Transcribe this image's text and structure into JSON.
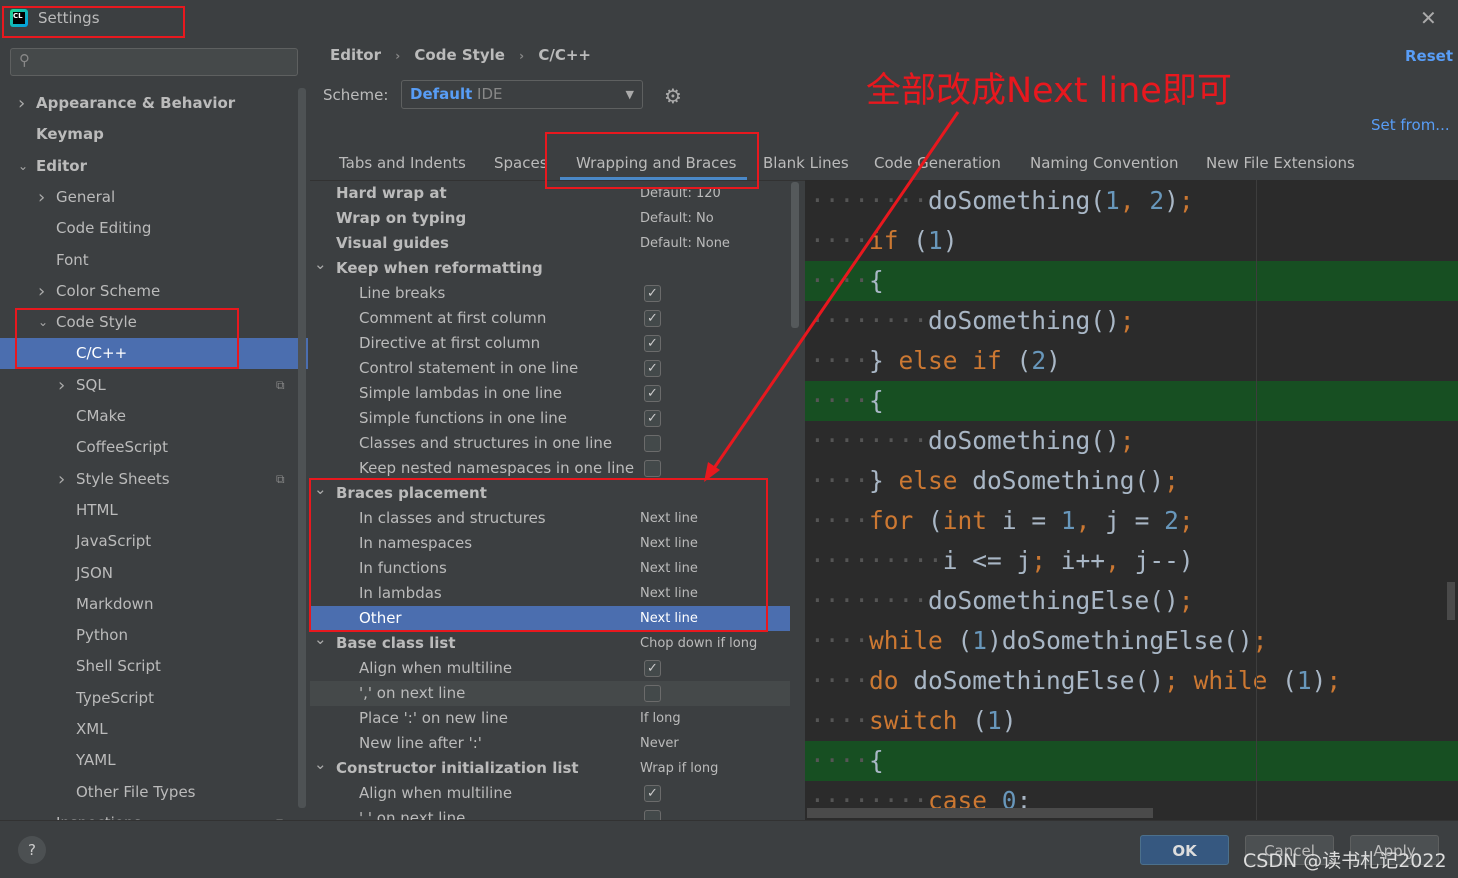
{
  "window": {
    "title": "Settings",
    "app_icon": "clion-icon"
  },
  "search": {
    "placeholder": ""
  },
  "sidebar": {
    "items": [
      {
        "label": "Appearance & Behavior",
        "level": 0,
        "bold": true,
        "chevron": "right"
      },
      {
        "label": "Keymap",
        "level": 0,
        "bold": true
      },
      {
        "label": "Editor",
        "level": 0,
        "bold": true,
        "chevron": "down"
      },
      {
        "label": "General",
        "level": 1,
        "chevron": "right"
      },
      {
        "label": "Code Editing",
        "level": 1
      },
      {
        "label": "Font",
        "level": 1
      },
      {
        "label": "Color Scheme",
        "level": 1,
        "chevron": "right"
      },
      {
        "label": "Code Style",
        "level": 1,
        "chevron": "down"
      },
      {
        "label": "C/C++",
        "level": 2,
        "selected": true
      },
      {
        "label": "SQL",
        "level": 2,
        "chevron": "right",
        "copy": true
      },
      {
        "label": "CMake",
        "level": 2
      },
      {
        "label": "CoffeeScript",
        "level": 2
      },
      {
        "label": "Style Sheets",
        "level": 2,
        "chevron": "right",
        "copy": true
      },
      {
        "label": "HTML",
        "level": 2
      },
      {
        "label": "JavaScript",
        "level": 2
      },
      {
        "label": "JSON",
        "level": 2
      },
      {
        "label": "Markdown",
        "level": 2
      },
      {
        "label": "Python",
        "level": 2
      },
      {
        "label": "Shell Script",
        "level": 2
      },
      {
        "label": "TypeScript",
        "level": 2
      },
      {
        "label": "XML",
        "level": 2
      },
      {
        "label": "YAML",
        "level": 2
      },
      {
        "label": "Other File Types",
        "level": 2
      },
      {
        "label": "Inspections",
        "level": 1,
        "copy": true
      }
    ]
  },
  "breadcrumb": [
    "Editor",
    "Code Style",
    "C/C++"
  ],
  "reset_label": "Reset",
  "scheme": {
    "label": "Scheme:",
    "value": "Default",
    "suffix": "IDE"
  },
  "set_from_label": "Set from...",
  "tabs": [
    {
      "label": "Tabs and Indents"
    },
    {
      "label": "Spaces"
    },
    {
      "label": "Wrapping and Braces",
      "active": true
    },
    {
      "label": "Blank Lines"
    },
    {
      "label": "Code Generation"
    },
    {
      "label": "Naming Convention"
    },
    {
      "label": "New File Extensions"
    }
  ],
  "settings": [
    {
      "label": "Hard wrap at",
      "bold": true,
      "value": "Default: 120"
    },
    {
      "label": "Wrap on typing",
      "bold": true,
      "value": "Default: No"
    },
    {
      "label": "Visual guides",
      "bold": true,
      "value": "Default: None"
    },
    {
      "label": "Keep when reformatting",
      "bold": true,
      "group": true
    },
    {
      "label": "Line breaks",
      "checked": true
    },
    {
      "label": "Comment at first column",
      "checked": true
    },
    {
      "label": "Directive at first column",
      "checked": true
    },
    {
      "label": "Control statement in one line",
      "checked": true
    },
    {
      "label": "Simple lambdas in one line",
      "checked": true
    },
    {
      "label": "Simple functions in one line",
      "checked": true
    },
    {
      "label": "Classes and structures in one line",
      "checked": false
    },
    {
      "label": "Keep nested namespaces in one line",
      "checked": false
    },
    {
      "label": "Braces placement",
      "bold": true,
      "group": true
    },
    {
      "label": "In classes and structures",
      "value": "Next line"
    },
    {
      "label": "In namespaces",
      "value": "Next line"
    },
    {
      "label": "In functions",
      "value": "Next line"
    },
    {
      "label": "In lambdas",
      "value": "Next line"
    },
    {
      "label": "Other",
      "value": "Next line",
      "selected": true
    },
    {
      "label": "Base class list",
      "bold": true,
      "group": true,
      "value": "Chop down if long"
    },
    {
      "label": "Align when multiline",
      "checked": true
    },
    {
      "label": "',' on next line",
      "checked": false,
      "hover": true
    },
    {
      "label": "Place ':' on new line",
      "value": "If long"
    },
    {
      "label": "New line after ':'",
      "value": "Never"
    },
    {
      "label": "Constructor initialization list",
      "bold": true,
      "group": true,
      "value": "Wrap if long"
    },
    {
      "label": "Align when multiline",
      "checked": true
    },
    {
      "label": "',' on next line",
      "checked": false
    }
  ],
  "code_preview": [
    {
      "indent": 8,
      "t": [
        [
          "doSomething(",
          "p"
        ],
        [
          "1",
          "n"
        ],
        [
          ", ",
          "s"
        ],
        [
          "2",
          "n"
        ],
        [
          ")",
          "p"
        ],
        [
          ";",
          "s"
        ]
      ]
    },
    {
      "indent": 4,
      "t": [
        [
          "if",
          "k"
        ],
        [
          " (",
          "p"
        ],
        [
          "1",
          "n"
        ],
        [
          ")",
          "p"
        ]
      ]
    },
    {
      "indent": 4,
      "hl": true,
      "t": [
        [
          "{",
          "p"
        ]
      ]
    },
    {
      "indent": 8,
      "t": [
        [
          "doSomething()",
          "p"
        ],
        [
          ";",
          "s"
        ]
      ]
    },
    {
      "indent": 4,
      "t": [
        [
          "} ",
          "p"
        ],
        [
          "else if",
          "k"
        ],
        [
          " (",
          "p"
        ],
        [
          "2",
          "n"
        ],
        [
          ")",
          "p"
        ]
      ]
    },
    {
      "indent": 4,
      "hl": true,
      "t": [
        [
          "{",
          "p"
        ]
      ]
    },
    {
      "indent": 8,
      "t": [
        [
          "doSomething()",
          "p"
        ],
        [
          ";",
          "s"
        ]
      ]
    },
    {
      "indent": 4,
      "t": [
        [
          "} ",
          "p"
        ],
        [
          "else",
          "k"
        ],
        [
          " doSomething()",
          "p"
        ],
        [
          ";",
          "s"
        ]
      ]
    },
    {
      "indent": 4,
      "t": [
        [
          "for",
          "k"
        ],
        [
          " (",
          "p"
        ],
        [
          "int",
          "k"
        ],
        [
          " i = ",
          "p"
        ],
        [
          "1",
          "n"
        ],
        [
          ", ",
          "s"
        ],
        [
          "j = ",
          "p"
        ],
        [
          "2",
          "n"
        ],
        [
          ";",
          "s"
        ]
      ]
    },
    {
      "indent": 9,
      "t": [
        [
          "i <= j",
          "p"
        ],
        [
          "; ",
          "s"
        ],
        [
          "i++",
          "p"
        ],
        [
          ", ",
          "s"
        ],
        [
          "j--)",
          "p"
        ]
      ]
    },
    {
      "indent": 8,
      "t": [
        [
          "doSomethingElse()",
          "p"
        ],
        [
          ";",
          "s"
        ]
      ]
    },
    {
      "indent": 4,
      "t": [
        [
          "while",
          "k"
        ],
        [
          " (",
          "p"
        ],
        [
          "1",
          "n"
        ],
        [
          ")doSomethingElse()",
          "p"
        ],
        [
          ";",
          "s"
        ]
      ]
    },
    {
      "indent": 4,
      "t": [
        [
          "do",
          "k"
        ],
        [
          " doSomethingElse()",
          "p"
        ],
        [
          "; ",
          "s"
        ],
        [
          "while",
          "k"
        ],
        [
          " (",
          "p"
        ],
        [
          "1",
          "n"
        ],
        [
          ")",
          "p"
        ],
        [
          ";",
          "s"
        ]
      ]
    },
    {
      "indent": 4,
      "t": [
        [
          "switch",
          "k"
        ],
        [
          " (",
          "p"
        ],
        [
          "1",
          "n"
        ],
        [
          ")",
          "p"
        ]
      ]
    },
    {
      "indent": 4,
      "hl": true,
      "t": [
        [
          "{",
          "p"
        ]
      ]
    },
    {
      "indent": 8,
      "t": [
        [
          "case",
          "k"
        ],
        [
          " ",
          "p"
        ],
        [
          "0",
          "n"
        ],
        [
          ":",
          "p"
        ]
      ]
    }
  ],
  "footer": {
    "help": "?",
    "ok": "OK",
    "cancel": "Cancel",
    "apply": "Apply"
  },
  "annotation": {
    "text": "全部改成Next line即可",
    "color": "#e8181e"
  },
  "watermark": "CSDN @读书札记2022",
  "colors": {
    "selection": "#4b6eaf",
    "accent": "#589df6",
    "keyword": "#cc7832",
    "number": "#6897bb",
    "highlight": "#174f22"
  }
}
